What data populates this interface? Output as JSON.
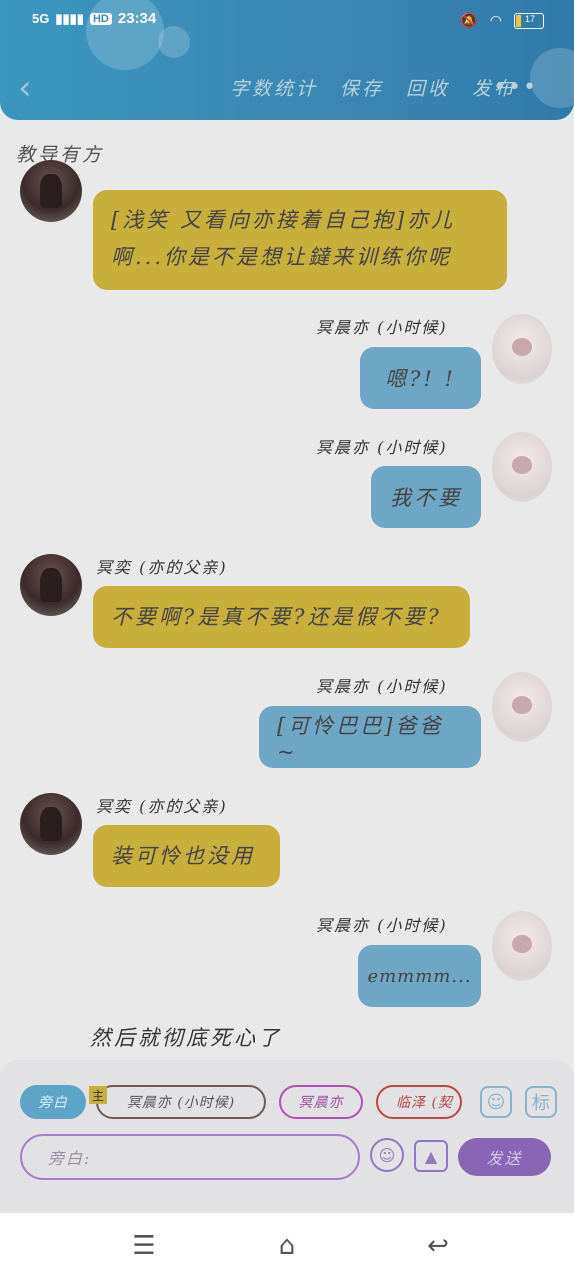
{
  "status_bar": {
    "network": "5G",
    "hd": "HD",
    "time": "23:34",
    "battery": "17"
  },
  "header": {
    "actions": [
      "字数统计",
      "保存",
      "回收",
      "发布"
    ],
    "more": "•••"
  },
  "document": {
    "title": "教导有方"
  },
  "messages": [
    {
      "side": "left",
      "name": "",
      "text": "[浅笑 又看向亦接着自己抱]亦儿啊...你是不是想让鐽来训练你呢"
    },
    {
      "side": "right",
      "name": "冥晨亦 (小时候)",
      "text": "嗯?! !"
    },
    {
      "side": "right",
      "name": "冥晨亦 (小时候)",
      "text": "我不要"
    },
    {
      "side": "left",
      "name": "冥奕 (亦的父亲)",
      "text": "不要啊?是真不要?还是假不要?"
    },
    {
      "side": "right",
      "name": "冥晨亦 (小时候)",
      "text": "[可怜巴巴]爸爸~"
    },
    {
      "side": "left",
      "name": "冥奕 (亦的父亲)",
      "text": "装可怜也没用"
    },
    {
      "side": "right",
      "name": "冥晨亦 (小时候)",
      "text": "emmmm..."
    }
  ],
  "narration": "然后就彻底死心了",
  "composer": {
    "chips": [
      "旁白",
      "冥晨亦 (小时候)",
      "冥晨亦",
      "临泽 (契"
    ],
    "main_tag": "主",
    "input_placeholder": "旁白:",
    "send": "发送",
    "tag_button": "标"
  },
  "colors": {
    "header": "#3b86b3",
    "bubble_left": "#c8ae3a",
    "bubble_right": "#6ea7c5",
    "send": "#8965b6"
  }
}
